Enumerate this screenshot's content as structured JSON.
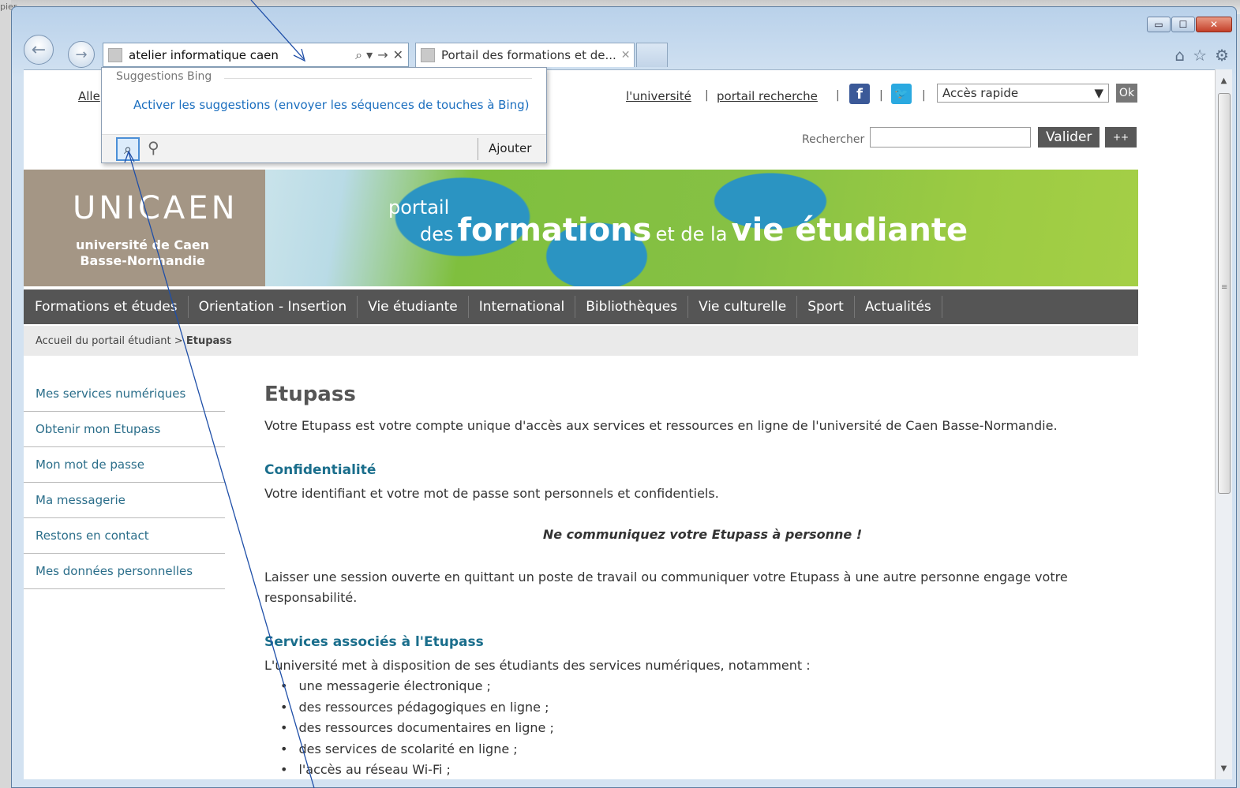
{
  "background": {
    "left_text": "pier"
  },
  "window": {
    "minimize_glyph": "▭",
    "maximize_glyph": "☐",
    "close_glyph": "✕"
  },
  "address_bar": {
    "value": "atelier informatique caen",
    "search_glyph": "⌕ ▾",
    "go_glyph": "→",
    "stop_glyph": "✕"
  },
  "tabs": [
    {
      "label": "Portail des formations et de...",
      "close_glyph": "✕"
    }
  ],
  "toolbar_icons": {
    "home": "⌂",
    "favorites": "☆",
    "tools": "⚙"
  },
  "nav": {
    "back_glyph": "←",
    "forward_glyph": "→"
  },
  "suggestions": {
    "header": "Suggestions Bing",
    "link": "Activer les suggestions (envoyer les séquences de touches à Bing)",
    "add_label": "Ajouter"
  },
  "page": {
    "hidden_link": "Alle",
    "top_links": {
      "universite": "l'université",
      "portail_recherche": "portail recherche"
    },
    "quick_access": {
      "value": "Accès rapide",
      "ok": "Ok"
    },
    "search": {
      "label": "Rechercher",
      "submit": "Valider",
      "advanced": "++"
    },
    "banner": {
      "logo_mark": "UNICAEN",
      "logo_line1": "université de Caen",
      "logo_line2": "Basse-Normandie",
      "portail": "portail",
      "des": "des",
      "formations": "formations",
      "et_de_la": "et de la",
      "vie_etudiante": "vie étudiante"
    },
    "menu": [
      "Formations et études",
      "Orientation - Insertion",
      "Vie étudiante",
      "International",
      "Bibliothèques",
      "Vie culturelle",
      "Sport",
      "Actualités"
    ],
    "breadcrumb": {
      "home": "Accueil du portail étudiant",
      "separator": ">",
      "current": "Etupass"
    },
    "sidebar": [
      "Mes services numériques",
      "Obtenir mon Etupass",
      "Mon mot de passe",
      "Ma messagerie",
      "Restons en contact",
      "Mes données personnelles"
    ],
    "content": {
      "title": "Etupass",
      "intro": "Votre Etupass est votre compte unique d'accès aux services et ressources en ligne de l'université de Caen Basse-Normandie.",
      "confidentiality_heading": "Confidentialité",
      "confidentiality_text": "Votre identifiant et votre mot de passe sont personnels et confidentiels.",
      "warning": "Ne communiquez votre Etupass à personne !",
      "session_text": "Laisser une session ouverte en quittant un poste de travail ou communiquer votre Etupass à une autre personne engage votre responsabilité.",
      "services_heading": "Services associés à l'Etupass",
      "services_intro": "L'université met à disposition de ses étudiants des services numériques, notamment :",
      "services": [
        "une messagerie électronique ;",
        "des ressources pédagogiques en ligne ;",
        "des ressources documentaires en ligne ;",
        "des services de scolarité en ligne ;",
        "l'accès au réseau Wi-Fi ;"
      ]
    }
  },
  "colors": {
    "menu_bg": "#555555",
    "link_teal": "#2b6e8a",
    "heading_teal": "#1a6e8c",
    "banner_green": "#86c144",
    "logo_taupe": "#a49685"
  }
}
